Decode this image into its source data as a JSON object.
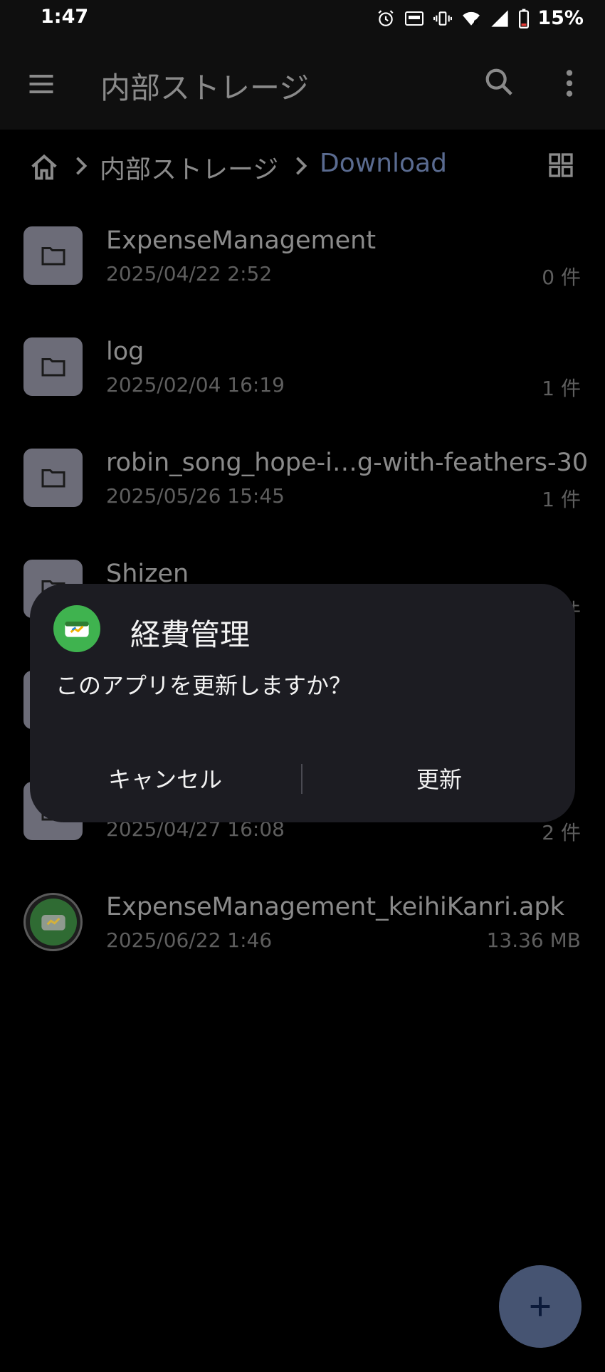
{
  "status_bar": {
    "time": "1:47",
    "battery": "15%",
    "icons": [
      "alarm-icon",
      "auto-brightness-icon",
      "vibrate-icon",
      "wifi-icon",
      "cellular-signal-icon",
      "battery-icon"
    ]
  },
  "app_bar": {
    "title": "内部ストレージ",
    "icons": [
      "menu-icon",
      "search-icon",
      "more-vert-icon"
    ]
  },
  "breadcrumb": {
    "items": [
      "内部ストレージ",
      "Download"
    ],
    "home_icon": "home-icon",
    "view_icon": "grid-view-icon"
  },
  "files": [
    {
      "name": "ExpenseManagement",
      "date": "2025/04/22 2:52",
      "count": "0 件",
      "type": "folder"
    },
    {
      "name": "log",
      "date": "2025/02/04 16:19",
      "count": "1 件",
      "type": "folder"
    },
    {
      "name": "robin_song_hope-i…g-with-feathers-30",
      "date": "2025/05/26 15:45",
      "count": "1 件",
      "type": "folder"
    },
    {
      "name": "Shizen",
      "date": "",
      "count": "件",
      "type": "folder"
    },
    {
      "name": "",
      "date": "",
      "count": "",
      "type": "folder"
    },
    {
      "name": "",
      "date": "2025/04/27 16:08",
      "count": "2 件",
      "type": "folder"
    },
    {
      "name": "ExpenseManagement_keihiKanri.apk",
      "date": "2025/06/22 1:46",
      "count": "13.36 MB",
      "type": "apk"
    }
  ],
  "dialog": {
    "title": "経費管理",
    "message": "このアプリを更新しますか？",
    "cancel_label": "キャンセル",
    "update_label": "更新"
  },
  "fab": {
    "label": "+",
    "icon": "add-icon"
  },
  "colors": {
    "background": "#000000",
    "app_bar": "#0f0f0f",
    "accent": "#5a6b90",
    "folder": "#6c6c78",
    "dialog": "#1c1c22",
    "fab": "#465472",
    "app_icon": "#3fb34f"
  }
}
